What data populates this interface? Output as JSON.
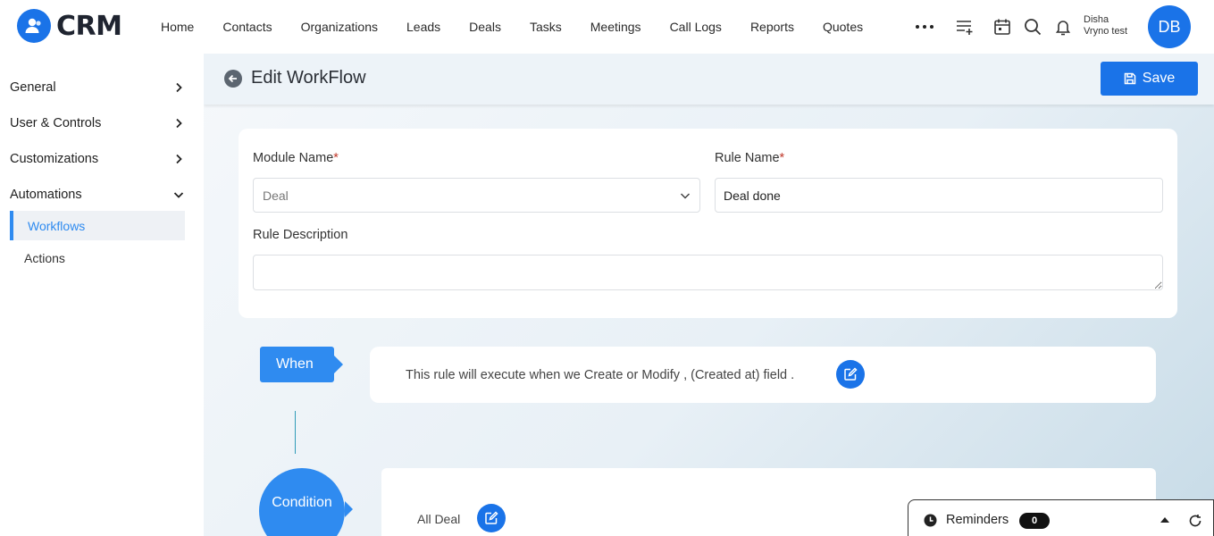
{
  "app": {
    "logo_text": "CRM"
  },
  "nav": {
    "items": [
      "Home",
      "Contacts",
      "Organizations",
      "Leads",
      "Deals",
      "Tasks",
      "Meetings",
      "Call Logs",
      "Reports",
      "Quotes"
    ]
  },
  "user": {
    "first_name": "Disha",
    "org": "Vryno test",
    "initials": "DB"
  },
  "sidebar": {
    "groups": [
      {
        "label": "General",
        "expanded": false
      },
      {
        "label": "User & Controls",
        "expanded": false
      },
      {
        "label": "Customizations",
        "expanded": false
      },
      {
        "label": "Automations",
        "expanded": true
      }
    ],
    "sub_items": [
      {
        "label": "Workflows",
        "active": true
      },
      {
        "label": "Actions",
        "active": false
      }
    ]
  },
  "page": {
    "title": "Edit WorkFlow",
    "save_label": "Save"
  },
  "form": {
    "module_label": "Module Name",
    "module_value": "Deal",
    "rule_name_label": "Rule Name",
    "rule_name_value": "Deal done",
    "required_mark": "*",
    "description_label": "Rule Description",
    "description_value": ""
  },
  "when": {
    "tag": "When",
    "text": "This rule will execute when we Create or Modify , (Created at) field ."
  },
  "condition": {
    "tag": "Condition",
    "text": "All Deal"
  },
  "reminders": {
    "label": "Reminders",
    "count": "0"
  },
  "colors": {
    "accent": "#1a73e8",
    "tag_blue": "#2f8bf0"
  }
}
